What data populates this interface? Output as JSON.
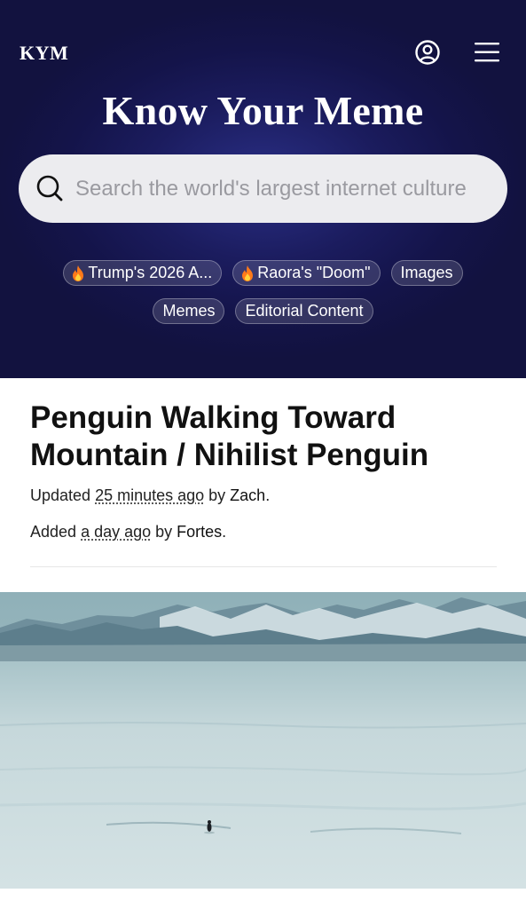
{
  "header": {
    "logo": "KYM",
    "site_title": "Know Your Meme",
    "account_icon": "account-circle-icon",
    "menu_icon": "hamburger-menu-icon",
    "background_color": "#16164d"
  },
  "search": {
    "placeholder": "Search the world's largest internet culture",
    "value": ""
  },
  "chips": {
    "trending_1": "Trump's 2026 A...",
    "trending_2": "Raora's \"Doom\"",
    "images": "Images",
    "memes": "Memes",
    "editorial": "Editorial Content",
    "trending_icon": "fire-icon"
  },
  "article": {
    "title_line1": "Penguin Walking Toward",
    "title_line2": "Mountain / Nihilist Penguin",
    "updated_prefix": "Updated ",
    "updated_time": "25 minutes ago",
    "updated_by": " by ",
    "updated_author": "Zach",
    "added_prefix": "Added ",
    "added_time": "a day ago",
    "added_by": " by ",
    "added_author": "Fortes",
    "period": "."
  },
  "image": {
    "subject": "penguin walking across antarctic ice toward mountains"
  }
}
